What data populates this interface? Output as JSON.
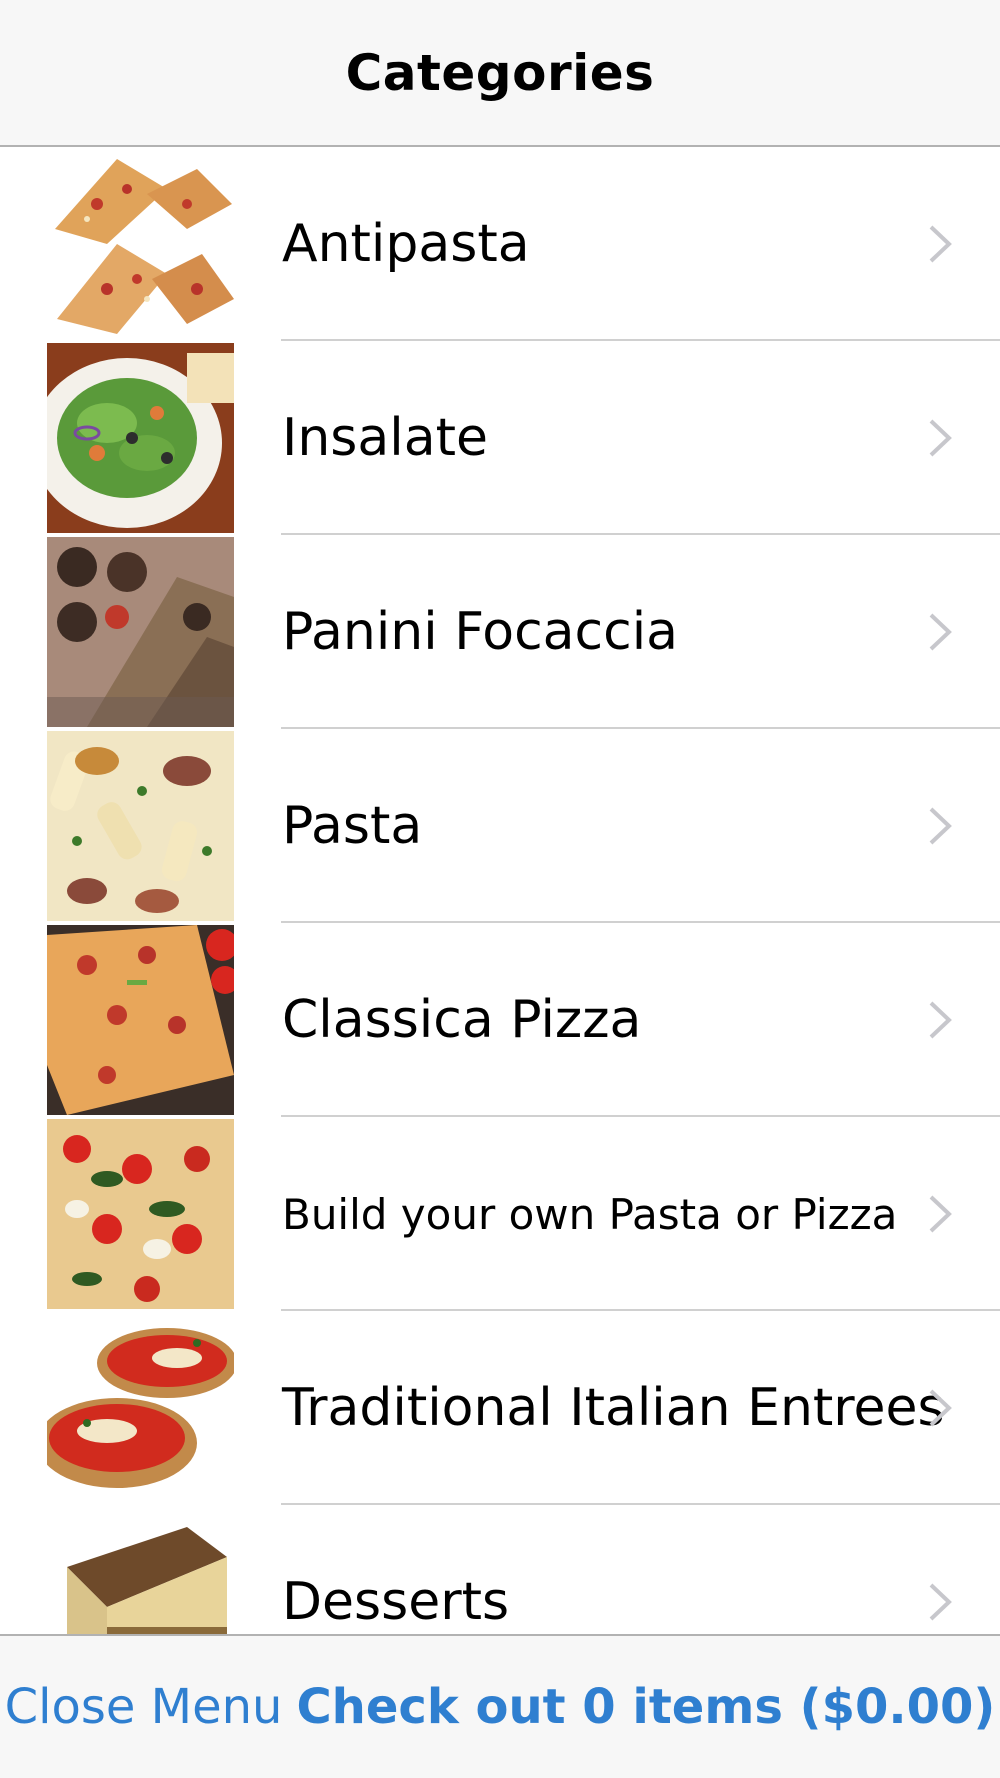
{
  "nav": {
    "title": "Categories"
  },
  "categories": [
    {
      "label": "Antipasta",
      "image": "bruschetta-photo"
    },
    {
      "label": "Insalate",
      "image": "salad-photo"
    },
    {
      "label": "Panini Focaccia",
      "image": "focaccia-photo"
    },
    {
      "label": "Pasta",
      "image": "pasta-photo"
    },
    {
      "label": "Classica Pizza",
      "image": "pizza-slice-photo"
    },
    {
      "label": "Build your own Pasta or Pizza",
      "image": "pizza-photo"
    },
    {
      "label": "Traditional Italian Entrees",
      "image": "parmigiana-photo"
    },
    {
      "label": "Desserts",
      "image": "tiramisu-photo"
    }
  ],
  "toolbar": {
    "close_label": "Close Menu",
    "checkout_label": "Check out 0 items ($0.00)"
  },
  "colors": {
    "accent": "#2f7fd0",
    "chevron": "#c7c7cc",
    "bar": "#f7f7f7"
  }
}
